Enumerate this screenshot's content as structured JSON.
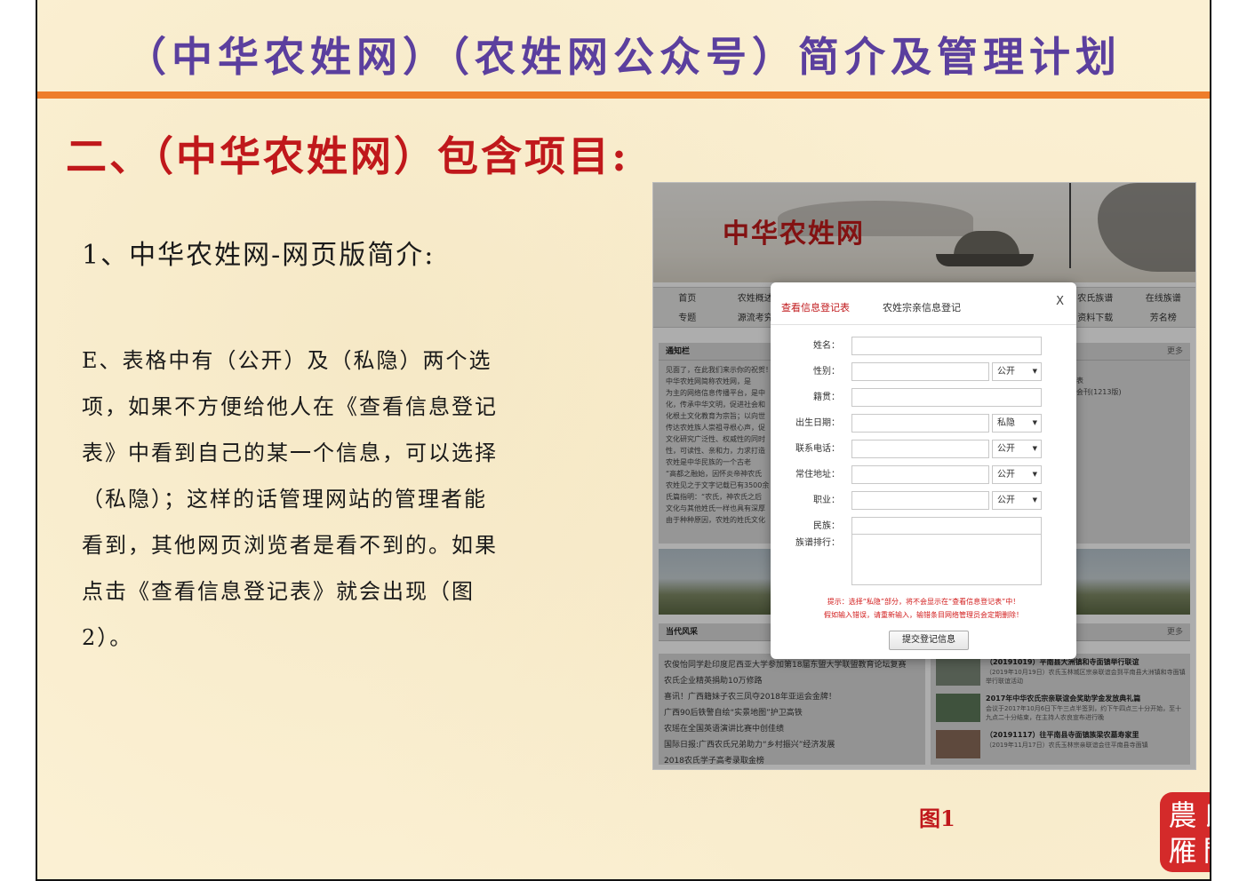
{
  "slide": {
    "title": "（中华农姓网）（农姓网公众号）简介及管理计划",
    "section_heading": "二、（中华农姓网）包含项目:",
    "subheading": "1、中华农姓网-网页版简介:",
    "body": "E、表格中有（公开）及（私隐）两个选项，如果不方便给他人在《查看信息登记表》中看到自己的某一个信息，可以选择（私隐）；这样的话管理网站的管理者能看到，其他网页浏览者是看不到的。如果点击《查看信息登记表》就会出现（图2）。",
    "caption": "图1",
    "seal": [
      "農",
      "氏",
      "雁",
      "門"
    ],
    "accent_color": "#ee7d2b",
    "title_color": "#5b3f9e",
    "heading_color": "#c0181b"
  },
  "site": {
    "logo": "中华农姓网",
    "nav_row1": [
      "首页",
      "农姓概述",
      "",
      "",
      "",
      "",
      "农氏族谱",
      "在线族谱"
    ],
    "nav_row2": [
      "专题",
      "源流考究",
      "",
      "",
      "",
      "",
      "资料下载",
      "芳名榜"
    ],
    "notice": {
      "title": "通知栏",
      "more": "更多",
      "lines": [
        "见面了，在此我们来示你的祝贺！",
        "中华农姓网简称农姓网，是",
        "为主的网络信息传播平台，是中",
        "化，传承中华文明，促进社会和",
        "化根土文化教育为宗旨；以向世",
        "传达农姓族人崇祖寻根心声，促",
        "文化研究广泛性、权威性的同时",
        "性，可读性、亲和力，力求打造",
        "农姓是中华民族的一个古老",
        "“高都之融始，因怀炎帝神农氏",
        "农姓见之于文字记载已有3500余",
        "氏篇指明：“农氏，神农氏之后",
        "文化与其他姓氏一样也具有深厚",
        "由于种种原因，农姓的姓氏文化"
      ],
      "right_lines": [
        "表",
        "会刊(1213版)"
      ]
    },
    "news": {
      "title": "当代风采",
      "more": "更多",
      "items": [
        "农俊怡同学赴印度尼西亚大学参加第18届东盟大学联盟教育论坛复赛",
        "农氏企业精英捐助10万修路",
        "喜讯！广西籍妹子农三凤夺2018年亚运会金牌！",
        "广西90后铁警自绘“实景地图”护卫高铁",
        "农瑶在全国英语演讲比赛中创佳绩",
        "国际日报:广西农氏兄弟助力“乡村振兴”经济发展",
        "2018农氏学子高考录取金榜"
      ],
      "featured": [
        {
          "title": "（20191019）平南县大洲镇和寺面镇举行联谊",
          "sub": "（2019年10月19日）农氏玉林城区宗亲联谊会到平南县大洲镇和寺面镇举行联谊活动"
        },
        {
          "title": "2017年中华农氏宗亲联谊会奖助学金发放典礼篇",
          "sub": "会议于2017年10月6日下午三点半签到，约下午四点三十分开始，至十九点二十分结束，在主持人农良宣布进行晚"
        },
        {
          "title": "（20191117）往平南县寺面镇族梁农墓寿家里",
          "sub": "（2019年11月17日）农氏玉林宗亲联谊会往平南县寺面镇"
        }
      ]
    },
    "modal": {
      "tab_active": "查看信息登记表",
      "tab_other": "农姓宗亲信息登记",
      "close": "X",
      "fields": [
        {
          "label": "姓名：",
          "select": null
        },
        {
          "label": "性别：",
          "select": "公开"
        },
        {
          "label": "籍贯：",
          "select": null
        },
        {
          "label": "出生日期：",
          "select": "私隐"
        },
        {
          "label": "联系电话：",
          "select": "公开"
        },
        {
          "label": "常住地址：",
          "select": "公开"
        },
        {
          "label": "职业：",
          "select": "公开"
        },
        {
          "label": "民族：",
          "select": null
        }
      ],
      "textarea_label": "族谱排行：",
      "hint1": "提示：选择“私隐”部分，将不会显示在“查看信息登记表”中！",
      "hint2": "假如输入错误，请重新输入，输错条目网络管理员会定期删除！",
      "submit": "提交登记信息"
    }
  }
}
